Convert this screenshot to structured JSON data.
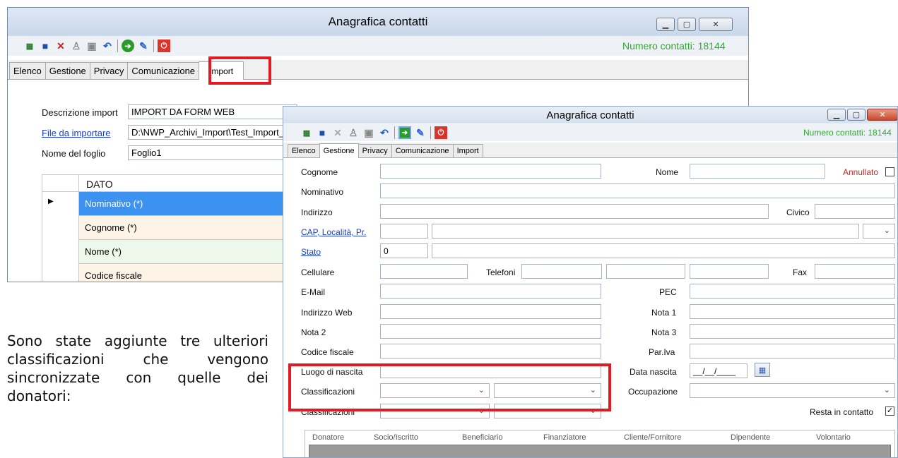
{
  "back_window": {
    "title": "Anagrafica contatti",
    "contact_count": "Numero contatti: 18144",
    "tabs": [
      "Elenco",
      "Gestione",
      "Privacy",
      "Comunicazione",
      "Import"
    ],
    "form": {
      "descrizione_label": "Descrizione import",
      "descrizione_value": "IMPORT DA FORM WEB",
      "file_label": "File da importare",
      "file_value": "D:\\NWP_Archivi_Import\\Test_Import_",
      "foglio_label": "Nome del foglio",
      "foglio_value": "Foglio1"
    },
    "grid": {
      "header": "DATO",
      "rows": [
        "Nominativo (*)",
        "Cognome (*)",
        "Nome (*)",
        "Codice fiscale"
      ]
    }
  },
  "caption": "Sono state aggiunte tre ulteriori classificazioni che vengono sincronizzate con quelle dei donatori:",
  "front_window": {
    "title": "Anagrafica contatti",
    "contact_count": "Numero contatti: 18144",
    "tabs": [
      "Elenco",
      "Gestione",
      "Privacy",
      "Comunicazione",
      "Import"
    ],
    "labels": {
      "cognome": "Cognome",
      "nome": "Nome",
      "annullato": "Annullato",
      "nominativo": "Nominativo",
      "indirizzo": "Indirizzo",
      "civico": "Civico",
      "cap": "CAP, Località, Pr.",
      "stato": "Stato",
      "cellulare": "Cellulare",
      "telefoni": "Telefoni",
      "fax": "Fax",
      "email": "E-Mail",
      "pec": "PEC",
      "web": "Indirizzo Web",
      "nota1": "Nota 1",
      "nota2": "Nota 2",
      "nota3": "Nota 3",
      "cf": "Codice fiscale",
      "piva": "Par.Iva",
      "luogo": "Luogo di nascita",
      "data": "Data nascita",
      "class1": "Classificazioni",
      "class2": "Classificazioni",
      "occupazione": "Occupazione",
      "resta": "Resta in contatto"
    },
    "values": {
      "stato": "0",
      "data_nascita": "__/__/____",
      "resta_checked": "✓"
    },
    "category_headers": [
      "Donatore",
      "Socio/Iscritto",
      "Beneficiario",
      "Finanziatore",
      "Cliente/Fornitore",
      "Dipendente",
      "Volontario"
    ]
  }
}
